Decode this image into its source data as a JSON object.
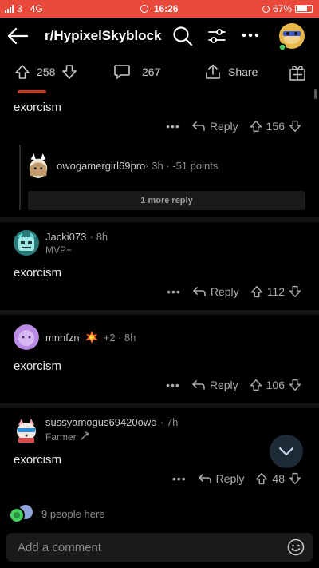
{
  "status_bar": {
    "carrier": "3",
    "network": "4G",
    "time": "16:26",
    "battery": "67%"
  },
  "header": {
    "title": "r/HypixelSkyblock"
  },
  "post_bar": {
    "upvotes": "258",
    "comments": "267",
    "share_label": "Share"
  },
  "comments": [
    {
      "text": "exorcism",
      "reply_label": "Reply",
      "score": "156"
    },
    {
      "username": "owogamergirl69pro",
      "meta": " · 3h · -51 points",
      "more_replies": "1 more reply"
    },
    {
      "username": "Jacki073",
      "meta": " · 8h",
      "flair": "MVP+",
      "text": "exorcism",
      "reply_label": "Reply",
      "score": "112"
    },
    {
      "username": "mnhfzn",
      "meta": "+2 · 8h",
      "text": "exorcism",
      "reply_label": "Reply",
      "score": "106"
    },
    {
      "username": "sussyamogus69420owo",
      "meta": " · 7h",
      "flair": "Farmer",
      "text": "exorcism",
      "reply_label": "Reply",
      "score": "48"
    }
  ],
  "footer": {
    "people_here": "9 people here",
    "comment_placeholder": "Add a comment"
  },
  "colors": {
    "status_bar": "#e8493b",
    "background": "#000000",
    "separator": "#141414",
    "input_bg": "#1a1a1b",
    "fab_bg": "#1f2a38"
  }
}
